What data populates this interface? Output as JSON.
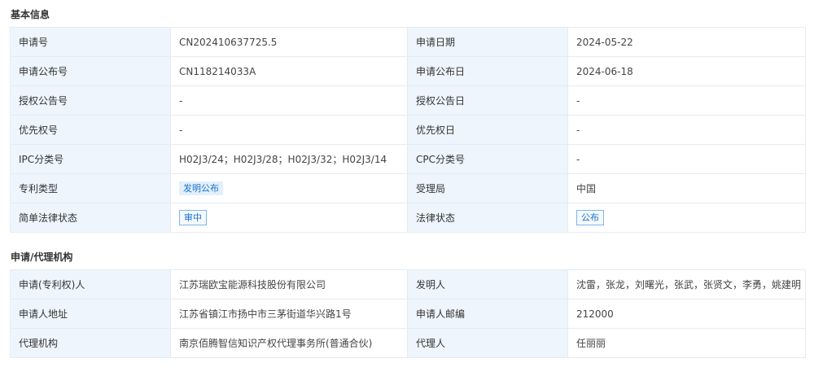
{
  "basic": {
    "title": "基本信息",
    "rows": [
      {
        "l1": "申请号",
        "v1": "CN202410637725.5",
        "l2": "申请日期",
        "v2": "2024-05-22"
      },
      {
        "l1": "申请公布号",
        "v1": "CN118214033A",
        "l2": "申请公布日",
        "v2": "2024-06-18"
      },
      {
        "l1": "授权公告号",
        "v1": "-",
        "l2": "授权公告日",
        "v2": "-"
      },
      {
        "l1": "优先权号",
        "v1": "-",
        "l2": "优先权日",
        "v2": "-"
      },
      {
        "l1": "IPC分类号",
        "v1": "H02J3/24；H02J3/28；H02J3/32；H02J3/14",
        "l2": "CPC分类号",
        "v2": "-"
      },
      {
        "l1": "专利类型",
        "v1": "发明公布",
        "l2": "受理局",
        "v2": "中国"
      },
      {
        "l1": "简单法律状态",
        "v1": "审中",
        "l2": "法律状态",
        "v2": "公布"
      }
    ]
  },
  "agency": {
    "title": "申请/代理机构",
    "rows": [
      {
        "l1": "申请(专利权)人",
        "v1": "江苏瑞欧宝能源科技股份有限公司",
        "l2": "发明人",
        "v2": "沈雷，张龙，刘曙光，张武，张贤文，李勇，姚建明"
      },
      {
        "l1": "申请人地址",
        "v1": "江苏省镇江市扬中市三茅街道华兴路1号",
        "l2": "申请人邮编",
        "v2": "212000"
      },
      {
        "l1": "代理机构",
        "v1": "南京佰腾智信知识产权代理事务所(普通合伙)",
        "l2": "代理人",
        "v2": "任丽丽"
      }
    ]
  },
  "colors": {
    "label_bg": "#eef5fd",
    "border": "#e4ebf3",
    "link": "#1a73c8"
  }
}
